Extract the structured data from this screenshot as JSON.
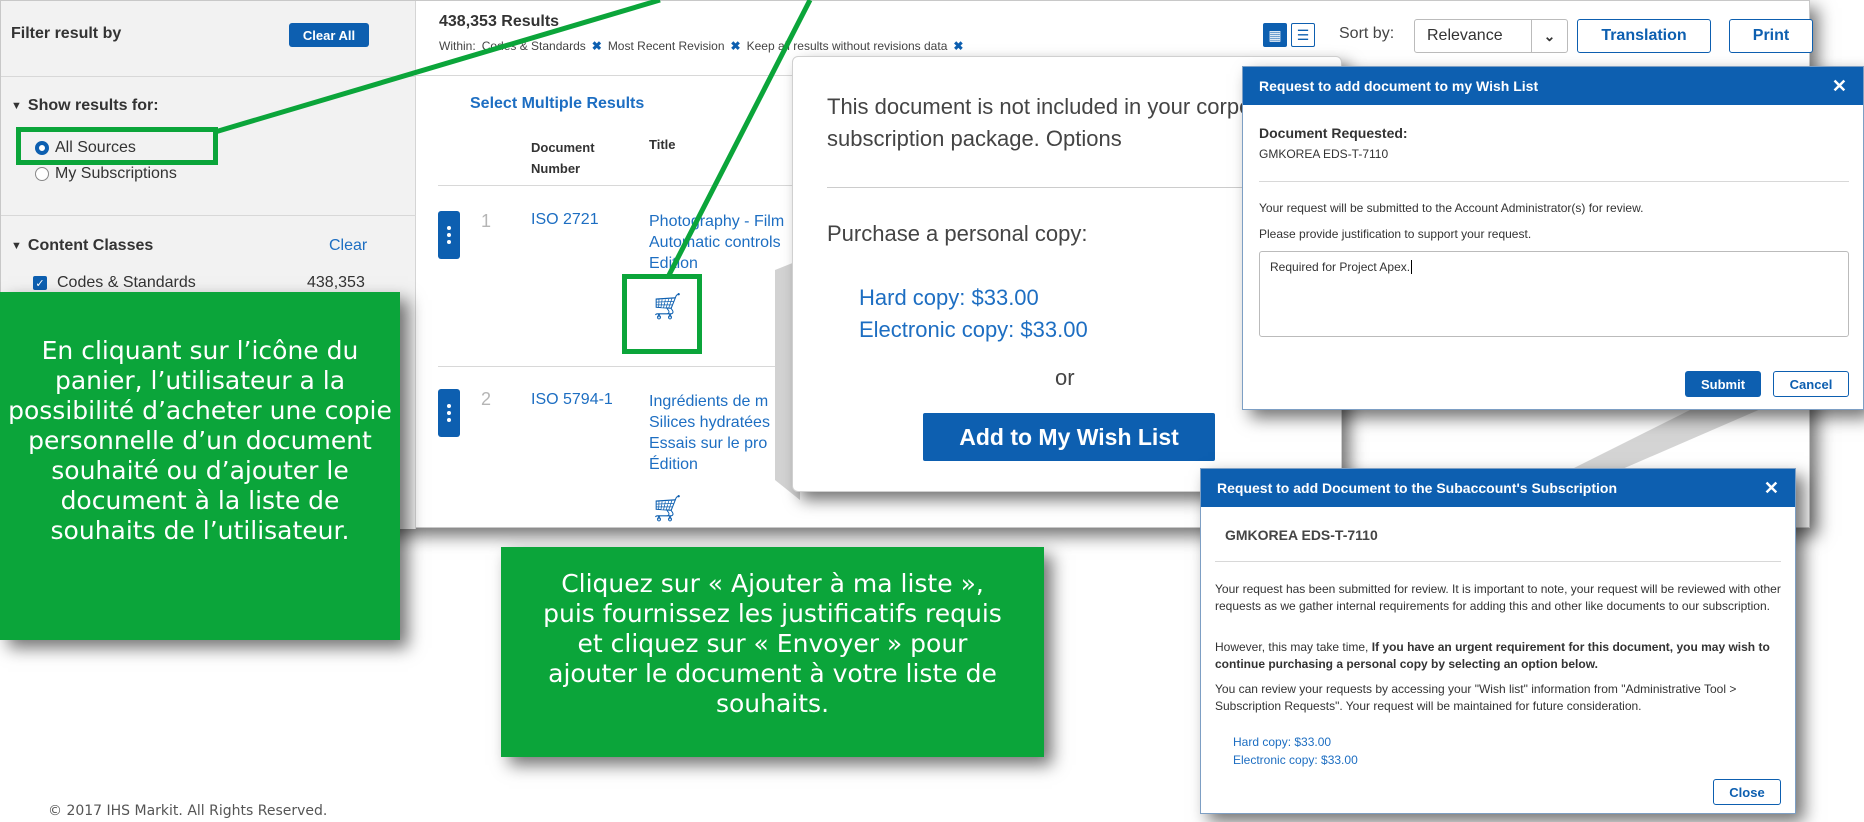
{
  "sidebar": {
    "filter_title": "Filter result by",
    "clear_all": "Clear All",
    "show_results_title": "Show results for:",
    "all_sources": "All Sources",
    "my_subscriptions": "My Subscriptions",
    "content_classes_title": "Content Classes",
    "clear": "Clear",
    "codes_standards": "Codes & Standards",
    "codes_standards_count": "438,353"
  },
  "results": {
    "count": "438,353 Results",
    "within_label": "Within:",
    "filter_1": "Codes & Standards",
    "filter_2": "Most Recent Revision",
    "filter_3": "Keep all results without revisions data",
    "select_multiple": "Select Multiple Results",
    "col_docnum": "Document Number",
    "col_title": "Title",
    "rows": [
      {
        "n": "1",
        "doc": "ISO 2721",
        "title": "Photography - Film\nAutomatic controls\nEdition"
      },
      {
        "n": "2",
        "doc": "ISO 5794-1",
        "title": "Ingrédients de m\nSilices hydratées\nEssais sur le pro\nÉdition"
      }
    ]
  },
  "toolbar": {
    "sort_by": "Sort by:",
    "relevance": "Relevance",
    "translation": "Translation",
    "print": "Print"
  },
  "purchase_popup": {
    "text": "This document is not included in your corporate subscription package. Options",
    "purchase_title": "Purchase a personal copy:",
    "hard_copy": "Hard copy: $33.00",
    "electronic_copy": "Electronic copy: $33.00",
    "or": "or",
    "add_wishlist": "Add to My Wish List"
  },
  "wishlist_dialog": {
    "title": "Request to add document to my Wish List",
    "doc_requested_label": "Document Requested:",
    "doc_id": "GMKOREA EDS-T-7110",
    "line1": "Your request will be submitted to the Account Administrator(s) for review.",
    "line2": "Please provide justification to support your request.",
    "justification": "Required for Project Apex.",
    "submit": "Submit",
    "cancel": "Cancel"
  },
  "subaccount_dialog": {
    "title": "Request to add Document to the Subaccount's Subscription",
    "doc_id": "GMKOREA EDS-T-7110",
    "p1": "Your request has been submitted for review. It is important to note, your request will be reviewed with other requests as we gather internal requirements for adding this and other like documents to our subscription.",
    "p2_prefix": "However, this may take time, ",
    "p2_bold": "If you have an urgent requirement for this document, you may wish to continue purchasing a personal copy by selecting an option below.",
    "p3": "You can review your requests by accessing your \"Wish list\" information from \"Administrative Tool > Subscription Requests\". Your request will be maintained for future consideration.",
    "hard_copy": "Hard copy: $33.00",
    "electronic_copy": "Electronic copy: $33.00",
    "close": "Close"
  },
  "callouts": {
    "left": "En cliquant sur l’icône du panier, l’utilisateur a la possibilité d’acheter une copie personnelle d’un document souhaité ou d’ajouter le document à la liste de souhaits de l’utilisateur.",
    "center": "Cliquez sur « Ajouter à ma liste », puis fournissez les justificatifs requis et cliquez sur « Envoyer » pour ajouter le document à votre liste de souhaits."
  },
  "footer": "© 2017 IHS Markit. All Rights Reserved.",
  "colors": {
    "green": "#0ba53a",
    "blue": "#0d5fb0",
    "link": "#1d6ec2"
  }
}
